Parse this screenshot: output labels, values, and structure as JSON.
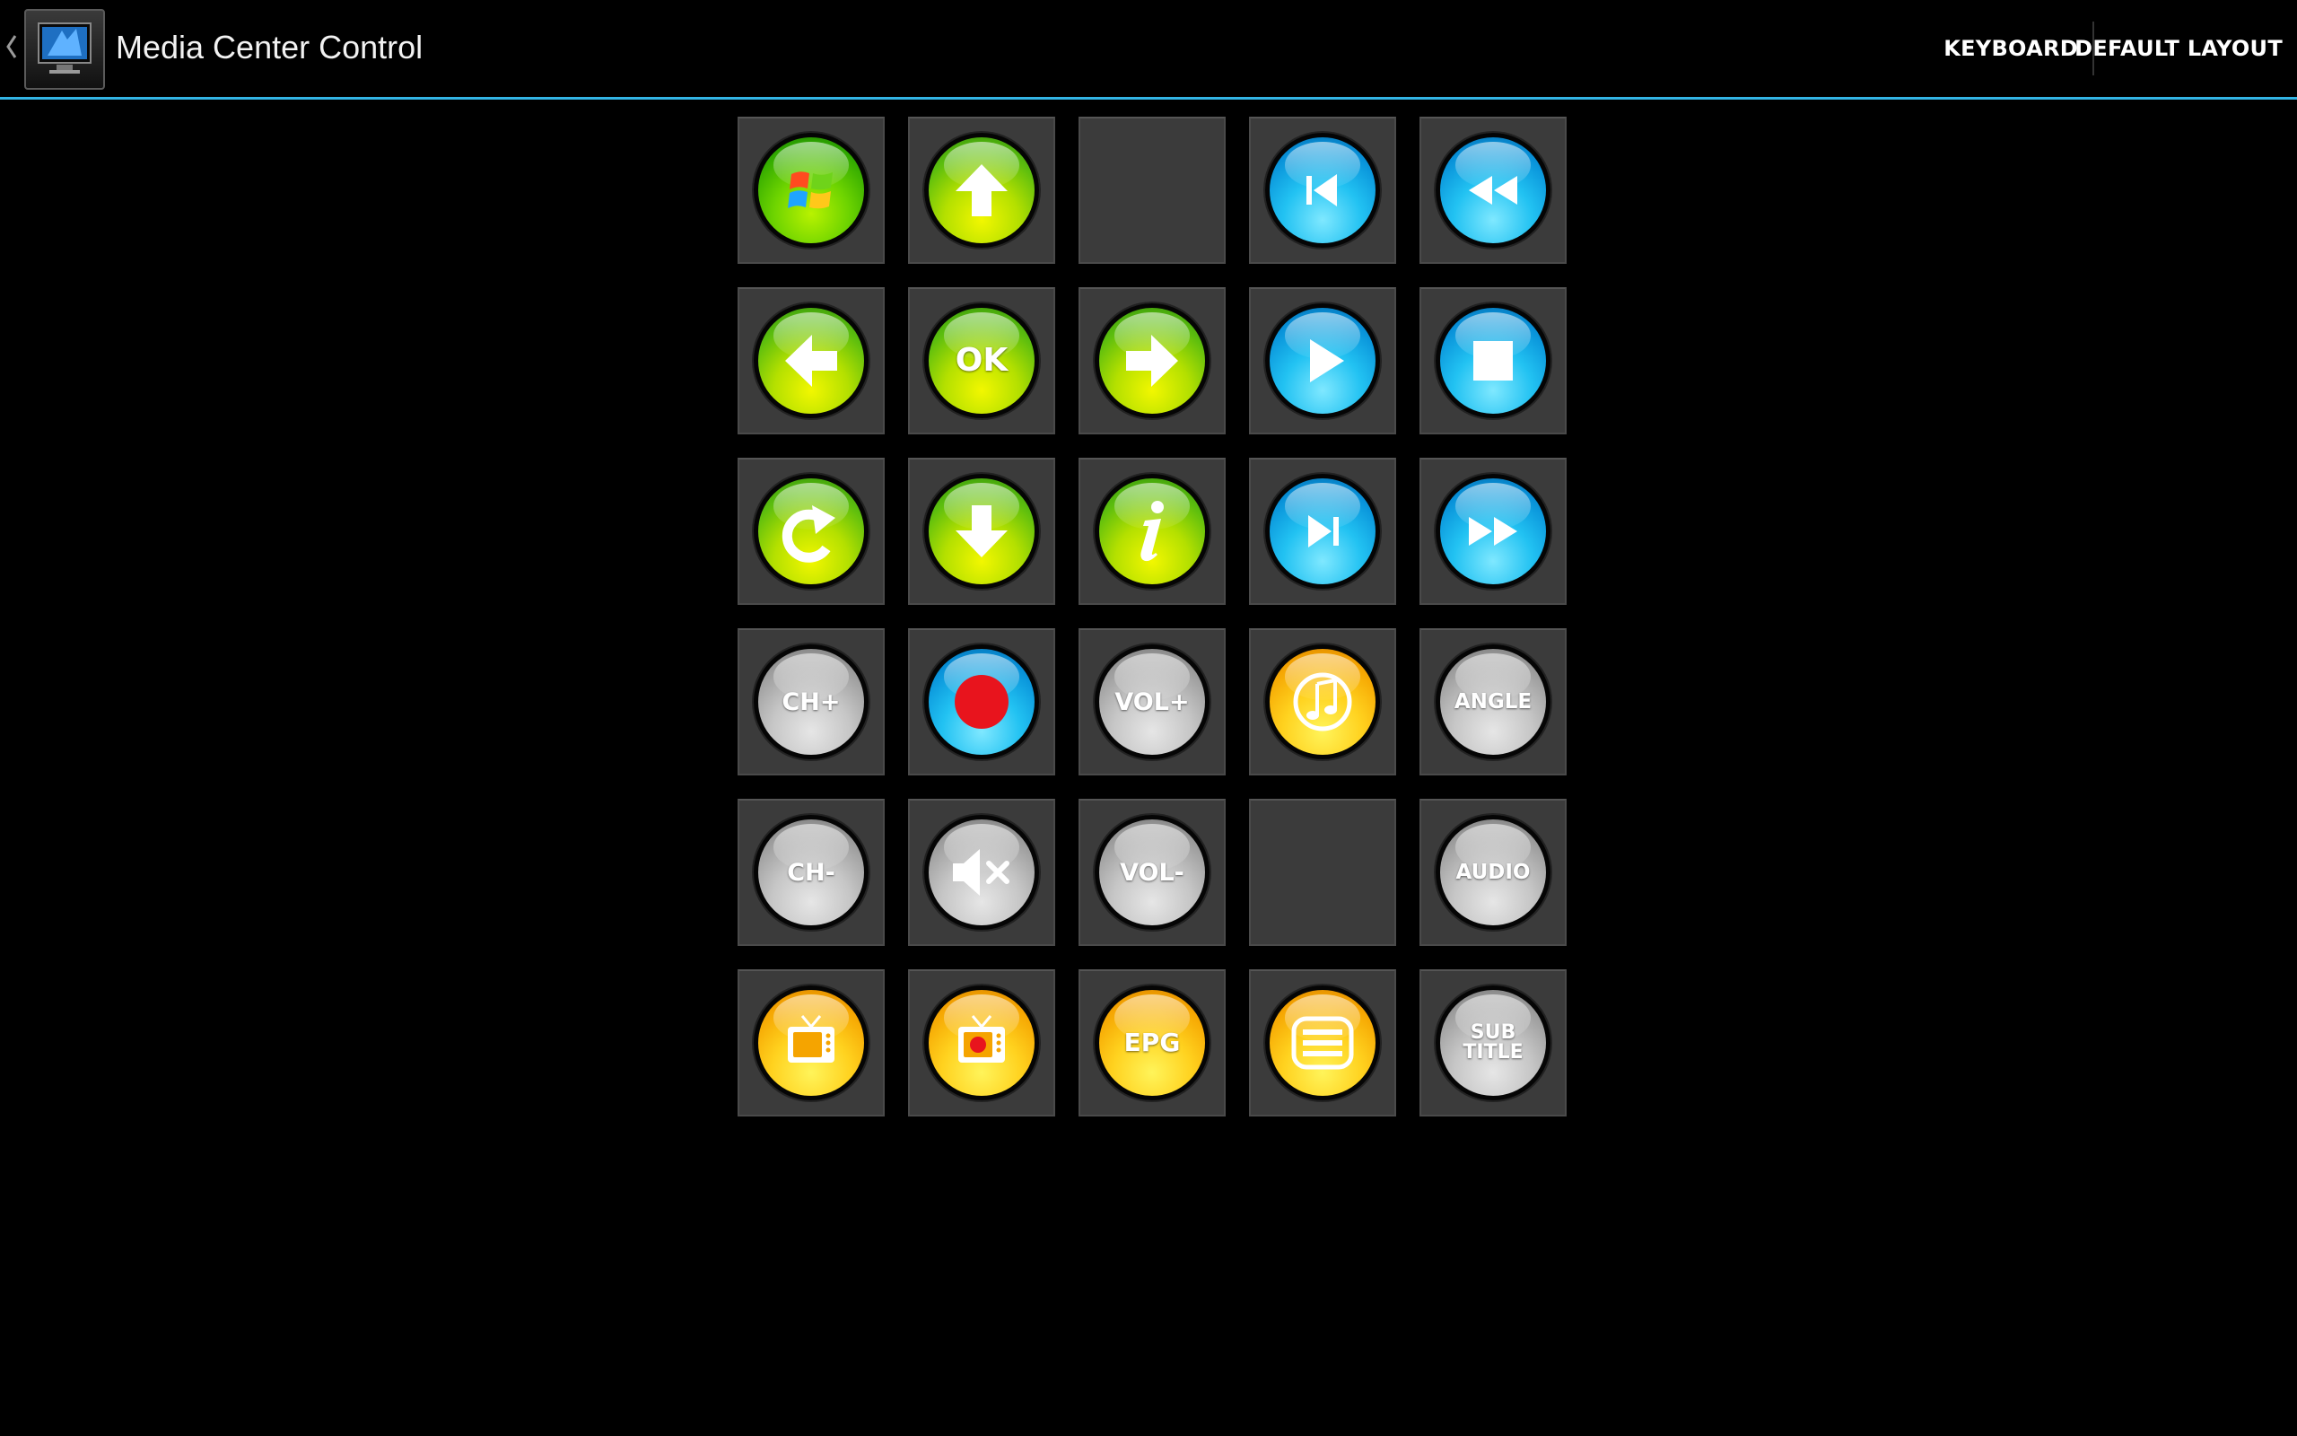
{
  "actionbar": {
    "title": "Media Center Control",
    "actions": {
      "keyboard": "KEYBOARD",
      "default_layout": "DEFAULT LAYOUT"
    },
    "accent_color": "#33b5e5"
  },
  "remote": {
    "tile_color": "#3b3b3b",
    "buttons": {
      "ok": "OK",
      "ch_up": "CH+",
      "ch_down": "CH-",
      "vol_up": "VOL+",
      "vol_down": "VOL-",
      "angle": "ANGLE",
      "audio": "AUDIO",
      "epg": "EPG",
      "subtitle_line1": "SUB",
      "subtitle_line2": "TITLE"
    },
    "icons": [
      "windows-start-icon",
      "arrow-up-icon",
      "skip-previous-icon",
      "rewind-icon",
      "arrow-left-icon",
      "arrow-right-icon",
      "play-icon",
      "stop-icon",
      "back-icon",
      "arrow-down-icon",
      "info-icon",
      "skip-next-icon",
      "fast-forward-icon",
      "record-icon",
      "music-icon",
      "mute-icon",
      "live-tv-icon",
      "recorded-tv-icon",
      "menu-list-icon"
    ]
  }
}
